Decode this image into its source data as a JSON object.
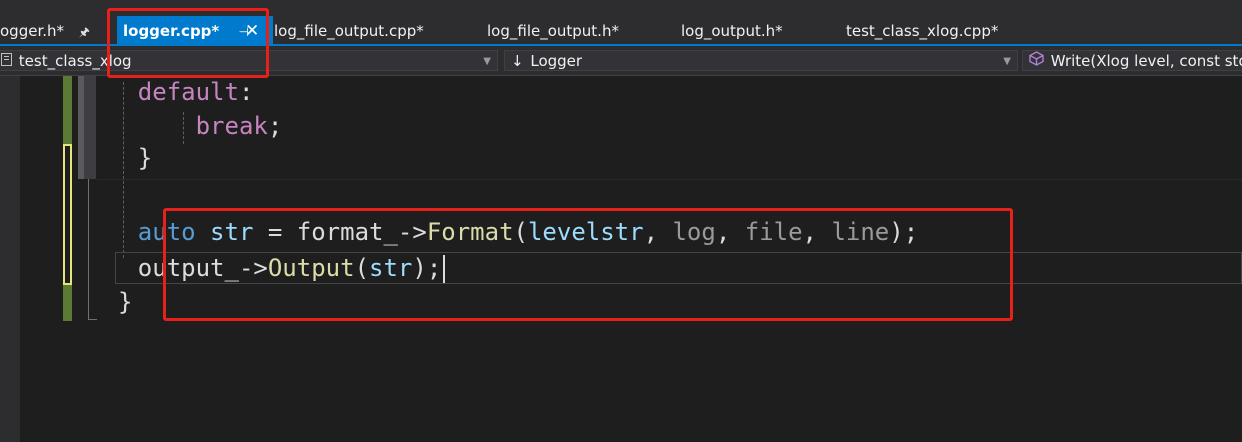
{
  "tabs": [
    {
      "label": "ogger.h*",
      "pin": "📌",
      "active": false
    },
    {
      "label": "logger.cpp*",
      "pin": "☐",
      "close": "✕",
      "active": true
    },
    {
      "label": "log_file_output.cpp*",
      "active": false
    },
    {
      "label": "log_file_output.h*",
      "active": false
    },
    {
      "label": "log_output.h*",
      "active": false
    },
    {
      "label": "test_class_xlog.cpp*",
      "active": false
    }
  ],
  "navbar": {
    "project": "test_class_xlog",
    "scope": "Logger",
    "member": "Write(Xlog level, const std::"
  },
  "code_lines": [
    {
      "indent": "    ",
      "tokens": [
        {
          "t": "default",
          "c": "kw"
        },
        {
          "t": ":",
          "c": "plain"
        }
      ]
    },
    {
      "indent": "        ",
      "tokens": [
        {
          "t": "break",
          "c": "kw"
        },
        {
          "t": ";",
          "c": "plain"
        }
      ]
    },
    {
      "indent": "    ",
      "tokens": [
        {
          "t": "}",
          "c": "plain"
        }
      ]
    },
    {
      "indent": "",
      "tokens": []
    },
    {
      "indent": "    ",
      "tokens": [
        {
          "t": "auto",
          "c": "kwb"
        },
        {
          "t": " ",
          "c": "plain"
        },
        {
          "t": "str",
          "c": "var"
        },
        {
          "t": " = ",
          "c": "plain"
        },
        {
          "t": "format_",
          "c": "plain"
        },
        {
          "t": "->",
          "c": "plain"
        },
        {
          "t": "Format",
          "c": "fn"
        },
        {
          "t": "(",
          "c": "plain"
        },
        {
          "t": "levelstr",
          "c": "var"
        },
        {
          "t": ", ",
          "c": "plain"
        },
        {
          "t": "log",
          "c": "par"
        },
        {
          "t": ", ",
          "c": "plain"
        },
        {
          "t": "file",
          "c": "par"
        },
        {
          "t": ", ",
          "c": "plain"
        },
        {
          "t": "line",
          "c": "par"
        },
        {
          "t": ");",
          "c": "plain"
        }
      ]
    },
    {
      "indent": "    ",
      "tokens": [
        {
          "t": "output_",
          "c": "plain"
        },
        {
          "t": "->",
          "c": "plain"
        },
        {
          "t": "Output",
          "c": "fn"
        },
        {
          "t": "(",
          "c": "plain"
        },
        {
          "t": "str",
          "c": "var"
        },
        {
          "t": ");",
          "c": "plain"
        }
      ],
      "cursor": true
    },
    {
      "indent": "",
      "tokens": [
        {
          "t": "}",
          "c": "plain"
        }
      ]
    }
  ],
  "colors": {
    "accent": "#007acc",
    "annotation_red": "#e8201a",
    "keyword_control": "#c586c0",
    "keyword": "#569cd6",
    "function": "#dcdcaa",
    "variable": "#9cdcfe",
    "parameter": "#9a9a9a",
    "text": "#dcdcdc",
    "background": "#1e1e1e"
  },
  "icons": {
    "project": "cpp-project-icon",
    "scope": "down-arrow-icon",
    "member": "method-cube-icon",
    "pin": "pin-icon",
    "close": "close-icon"
  }
}
